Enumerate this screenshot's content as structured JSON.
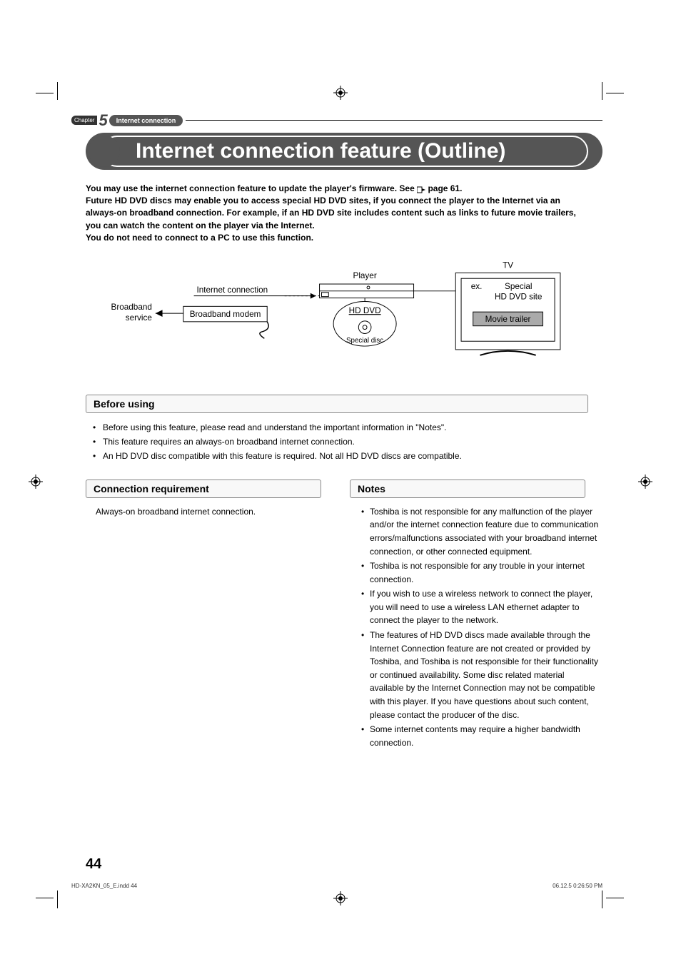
{
  "chapter": {
    "label": "Chapter",
    "number": "5",
    "title": "Internet connection"
  },
  "title": "Internet connection feature (Outline)",
  "intro": {
    "line1_pre": "You may use the internet connection feature to update the player's firmware. See ",
    "line1_post": " page 61.",
    "line2": "Future HD DVD discs may enable you to access special HD DVD sites, if you connect the player to the Internet via an always-on broadband connection. For example, if an HD DVD site includes content such as links to future movie trailers, you can watch the content on the player via the Internet.",
    "line3": "You do not need to connect to a PC to use this function."
  },
  "diagram": {
    "broadband_service": "Broadband\nservice",
    "internet_connection": "Internet connection",
    "broadband_modem": "Broadband modem",
    "player": "Player",
    "hd_dvd": "HD DVD",
    "special_disc": "Special disc",
    "tv": "TV",
    "ex": "ex.",
    "special_site": "Special\nHD DVD site",
    "movie_trailer": "Movie trailer"
  },
  "sections": {
    "before_using": {
      "heading": "Before using",
      "items": [
        "Before using this feature, please read and understand the important information in \"Notes\".",
        "This feature requires an always-on broadband internet connection.",
        "An HD DVD disc compatible with this feature is required. Not all HD DVD discs are compatible."
      ]
    },
    "connection_requirement": {
      "heading": "Connection requirement",
      "text": "Always-on broadband internet connection."
    },
    "notes": {
      "heading": "Notes",
      "items": [
        "Toshiba is not responsible for any malfunction of the player and/or the internet connection feature due to communication errors/malfunctions associated with your broadband internet connection, or other connected equipment.",
        "Toshiba is not responsible for any trouble in your internet connection.",
        "If you wish to use a wireless network to connect the player, you will need to use a wireless LAN ethernet adapter to connect the player to the network.",
        "The features of HD DVD discs made available through the Internet Connection feature are not created or provided by Toshiba, and Toshiba is not responsible for their functionality or continued availability. Some disc related material available by the Internet Connection may not be compatible with this player. If you have questions about such content, please contact the producer of the disc.",
        "Some internet contents may require a higher bandwidth connection."
      ]
    }
  },
  "page_number": "44",
  "footer": {
    "left": "HD-XA2KN_05_E.indd   44",
    "right": "06.12.5   0:26:50 PM"
  }
}
